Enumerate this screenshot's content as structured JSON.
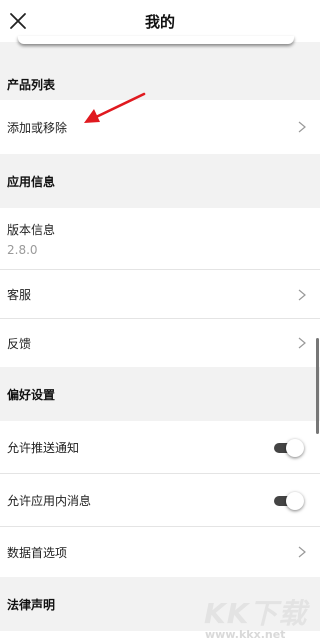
{
  "header": {
    "title": "我的",
    "close_icon": "close-icon"
  },
  "sections": {
    "products": {
      "title": "产品列表",
      "items": [
        {
          "label": "添加或移除",
          "icon": "chevron-right-icon"
        }
      ]
    },
    "app_info": {
      "title": "应用信息",
      "version_label": "版本信息",
      "version_value": "2.8.0",
      "items": [
        {
          "label": "客服",
          "icon": "chevron-right-icon"
        },
        {
          "label": "反馈",
          "icon": "chevron-right-icon"
        }
      ]
    },
    "preferences": {
      "title": "偏好设置",
      "toggles": [
        {
          "label": "允许推送通知",
          "on": true
        },
        {
          "label": "允许应用内消息",
          "on": true
        }
      ],
      "items": [
        {
          "label": "数据首选项",
          "icon": "chevron-right-icon"
        }
      ]
    },
    "legal": {
      "title": "法律声明"
    }
  },
  "annotation": {
    "arrow_color": "#e0191f"
  },
  "watermark": {
    "logo": "KK下载",
    "url": "www.kkx.net"
  }
}
